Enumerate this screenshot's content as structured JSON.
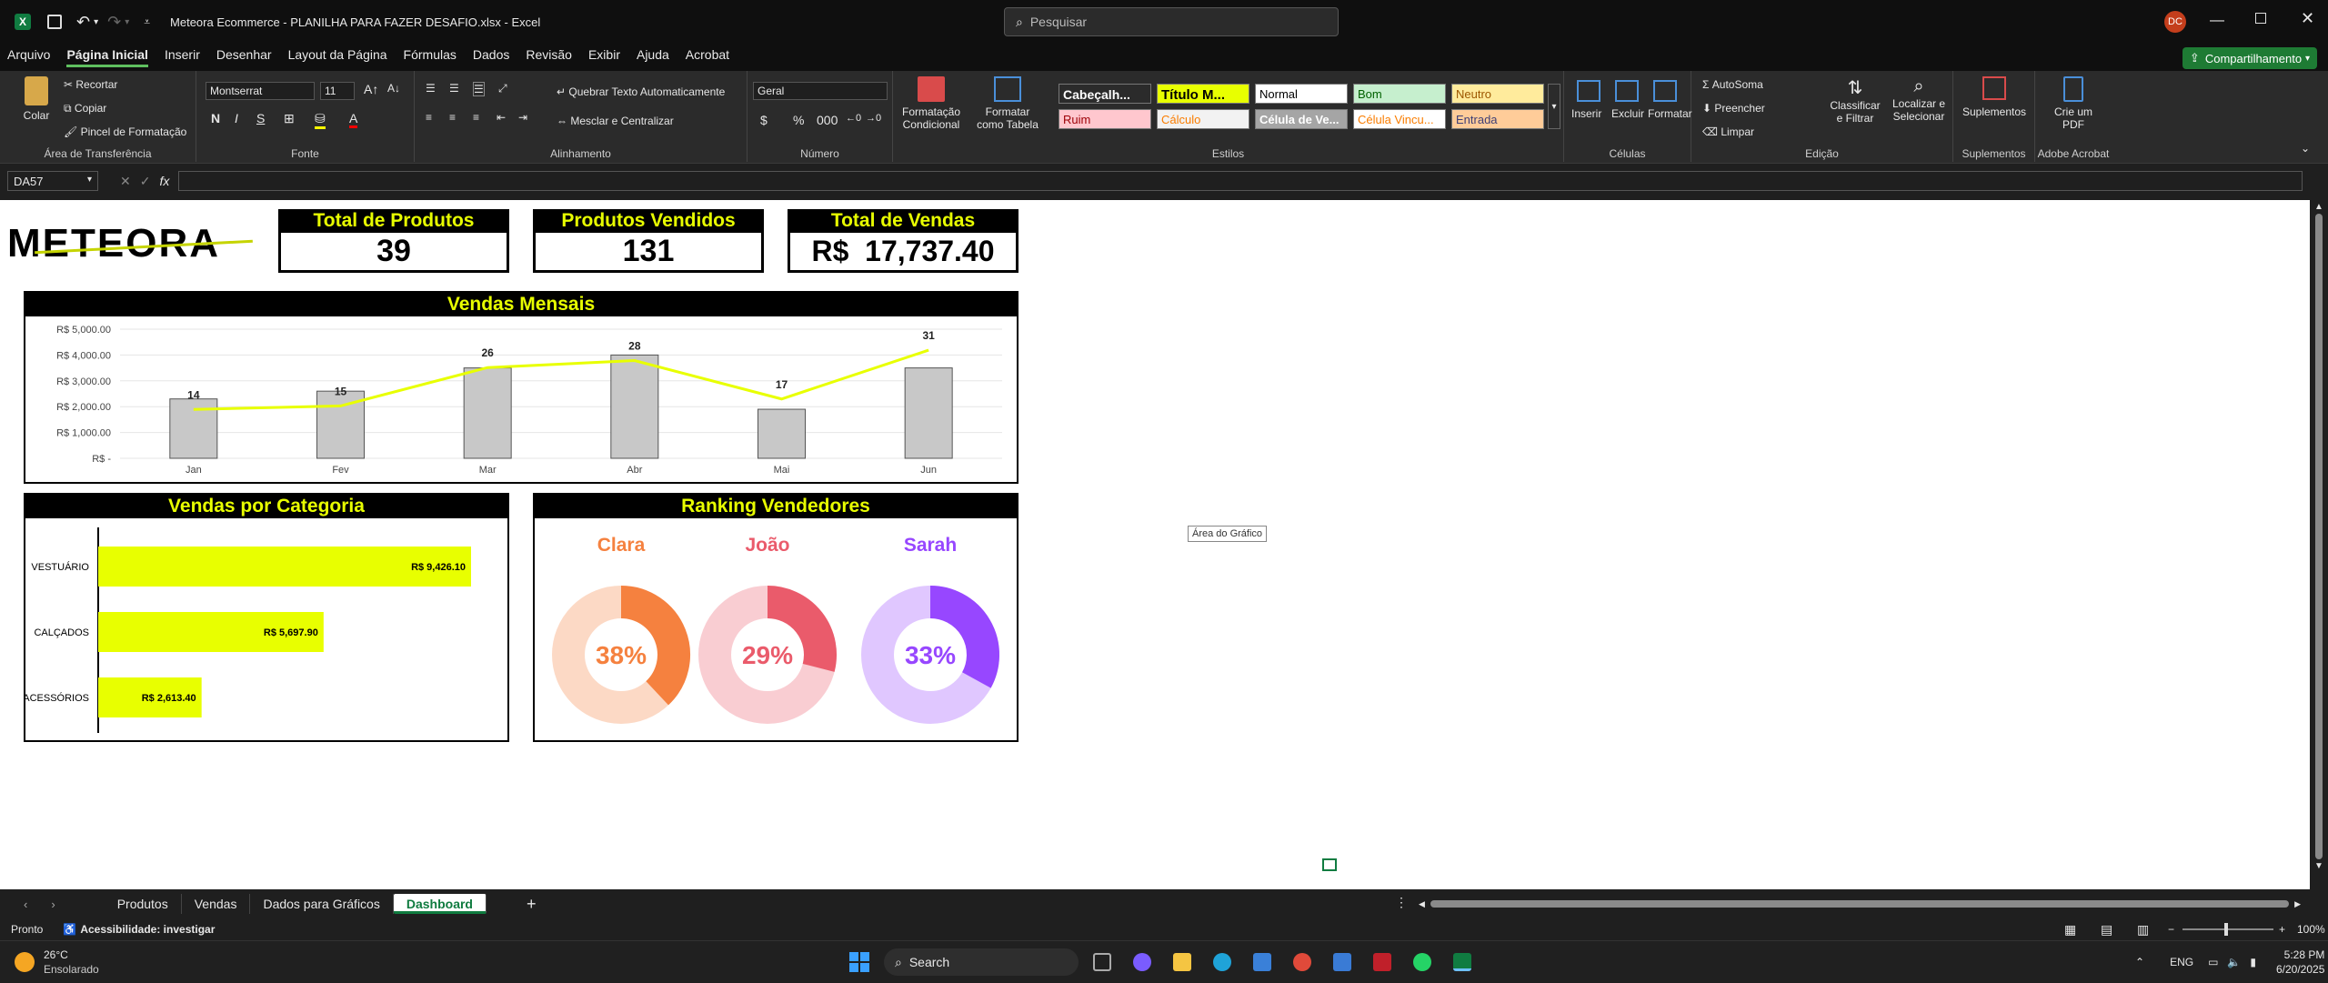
{
  "titlebar": {
    "file_title": "Meteora Ecommerce - PLANILHA PARA FAZER DESAFIO.xlsx",
    "app_suffix": "Excel",
    "search_placeholder": "Pesquisar",
    "avatar": "DC"
  },
  "menu": {
    "items": [
      "Arquivo",
      "Página Inicial",
      "Inserir",
      "Desenhar",
      "Layout da Página",
      "Fórmulas",
      "Dados",
      "Revisão",
      "Exibir",
      "Ajuda",
      "Acrobat"
    ],
    "share": "Compartilhamento"
  },
  "ribbon": {
    "clipboard": {
      "paste": "Colar",
      "cut": "Recortar",
      "copy": "Copiar",
      "painter": "Pincel de Formatação",
      "label": "Área de Transferência"
    },
    "font": {
      "name": "Montserrat",
      "size": "11",
      "label": "Fonte"
    },
    "alignment": {
      "wrap": "Quebrar Texto Automaticamente",
      "merge": "Mesclar e Centralizar",
      "label": "Alinhamento"
    },
    "number": {
      "format": "Geral",
      "label": "Número"
    },
    "styles": {
      "cond": "Formatação Condicional",
      "table": "Formatar como Tabela",
      "label": "Estilos",
      "cells": [
        "Cabeçalh...",
        "Título M...",
        "Normal",
        "Bom",
        "Neutro",
        "Ruim",
        "Cálculo",
        "Célula de Ve...",
        "Célula Vincu...",
        "Entrada"
      ]
    },
    "cells": {
      "insert": "Inserir",
      "delete": "Excluir",
      "format": "Formatar",
      "label": "Células"
    },
    "editing": {
      "autosum": "AutoSoma",
      "fill": "Preencher",
      "clear": "Limpar",
      "sort": "Classificar e Filtrar",
      "find": "Localizar e Selecionar",
      "label": "Edição"
    },
    "addins": {
      "btn": "Suplementos",
      "label": "Suplementos"
    },
    "acrobat": {
      "btn": "Crie um PDF",
      "label": "Adobe Acrobat"
    }
  },
  "formula_bar": {
    "name_box": "DA57",
    "fx": "fx",
    "content": ""
  },
  "dashboard": {
    "logo": "METEORA",
    "kpis": [
      {
        "title": "Total de Produtos",
        "value": "39"
      },
      {
        "title": "Produtos Vendidos",
        "value": "131"
      },
      {
        "title": "Total de Vendas",
        "value": "R$  17,737.40"
      }
    ],
    "tooltip": "Área do Gráfico"
  },
  "chart_data": [
    {
      "type": "bar",
      "title": "Vendas Mensais",
      "categories": [
        "Jan",
        "Fev",
        "Mar",
        "Abr",
        "Mai",
        "Jun"
      ],
      "series": [
        {
          "values": [
            2300,
            2600,
            3500,
            4000,
            1900,
            3500
          ]
        },
        {
          "values": [
            14,
            15,
            26,
            28,
            17,
            31
          ]
        }
      ],
      "data_labels": [
        "14",
        "15",
        "26",
        "28",
        "17",
        "31"
      ],
      "ytick_labels": [
        "R$ 5,000.00",
        "R$ 4,000.00",
        "R$ 3,000.00",
        "R$ 2,000.00",
        "R$ 1,000.00",
        "R$ -"
      ],
      "ylim": [
        0,
        5000
      ],
      "line_ylim": [
        0,
        37
      ],
      "colors": {
        "bar": "#c8c8c8",
        "line": "#e8ff00"
      }
    },
    {
      "type": "bar",
      "orientation": "horizontal",
      "title": "Vendas por Categoria",
      "categories": [
        "VESTUÁRIO",
        "CALÇADOS",
        "ACESSÓRIOS"
      ],
      "values": [
        9426.1,
        5697.9,
        2613.4
      ],
      "data_labels": [
        "R$ 9,426.10",
        "R$ 5,697.90",
        "R$ 2,613.40"
      ],
      "colors": {
        "bar": "#e8ff00"
      }
    },
    {
      "type": "pie",
      "title": "Ranking Vendedores",
      "series": [
        {
          "name": "Clara",
          "value": 38,
          "label": "38%",
          "color": "#f5813f"
        },
        {
          "name": "João",
          "value": 29,
          "label": "29%",
          "color": "#ea5b6b"
        },
        {
          "name": "Sarah",
          "value": 33,
          "label": "33%",
          "color": "#9747ff"
        }
      ]
    }
  ],
  "sheet_tabs": [
    "Produtos",
    "Vendas",
    "Dados para Gráficos",
    "Dashboard"
  ],
  "status": {
    "ready": "Pronto",
    "accessibility": "Acessibilidade: investigar",
    "zoom": "100%"
  },
  "taskbar": {
    "weather_temp": "26°C",
    "weather_desc": "Ensolarado",
    "search": "Search",
    "lang": "ENG",
    "time": "5:28 PM",
    "date": "6/20/2025"
  }
}
